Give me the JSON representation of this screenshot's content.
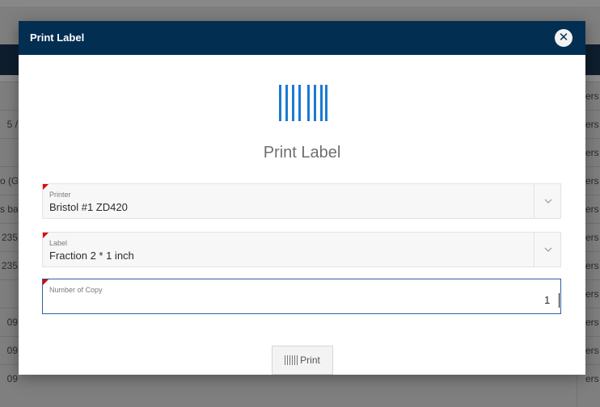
{
  "background": {
    "rows_left": [
      "",
      "5 / ",
      "",
      "o (G",
      "s ba",
      "235",
      "235",
      "",
      "09",
      "09",
      "09"
    ],
    "rows_right": [
      "ers",
      "ers",
      "ers",
      "ers",
      "ers",
      "ers",
      "ers",
      "ers",
      "ers",
      "ers",
      "ers"
    ]
  },
  "modal": {
    "title": "Print Label",
    "close_icon": "close-icon",
    "hero_icon": "barcode-icon",
    "hero_title": "Print Label"
  },
  "form": {
    "printer": {
      "label": "Printer",
      "value": "Bristol #1 ZD420"
    },
    "label": {
      "label": "Label",
      "value": "Fraction 2 * 1 inch"
    },
    "copies": {
      "label": "Number of Copy",
      "value": "1"
    }
  },
  "actions": {
    "print_label": "Print",
    "print_icon": "barcode-icon"
  },
  "colors": {
    "header_bg": "#012e51",
    "accent_blue": "#1a7ad4",
    "required_flag": "#e00000",
    "active_border": "#2f5f9f"
  }
}
